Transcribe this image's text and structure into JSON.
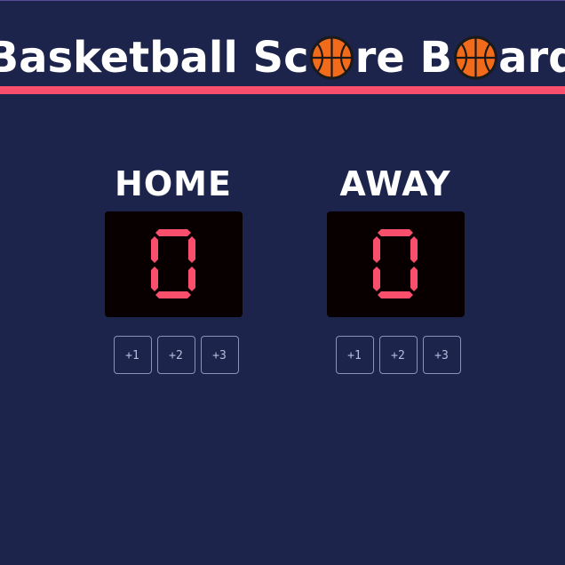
{
  "header": {
    "title_part1": "Basketball Sc",
    "title_part2": "re B",
    "title_part3": "ard",
    "ball_icon": "basketball-icon",
    "accent_color": "#f94f6d"
  },
  "teams": [
    {
      "name": "HOME",
      "score": "0",
      "buttons": [
        "+1",
        "+2",
        "+3"
      ]
    },
    {
      "name": "AWAY",
      "score": "0",
      "buttons": [
        "+1",
        "+2",
        "+3"
      ]
    }
  ],
  "colors": {
    "background": "#1c244b",
    "score_digit": "#f94f6d",
    "score_bg": "#080000"
  }
}
